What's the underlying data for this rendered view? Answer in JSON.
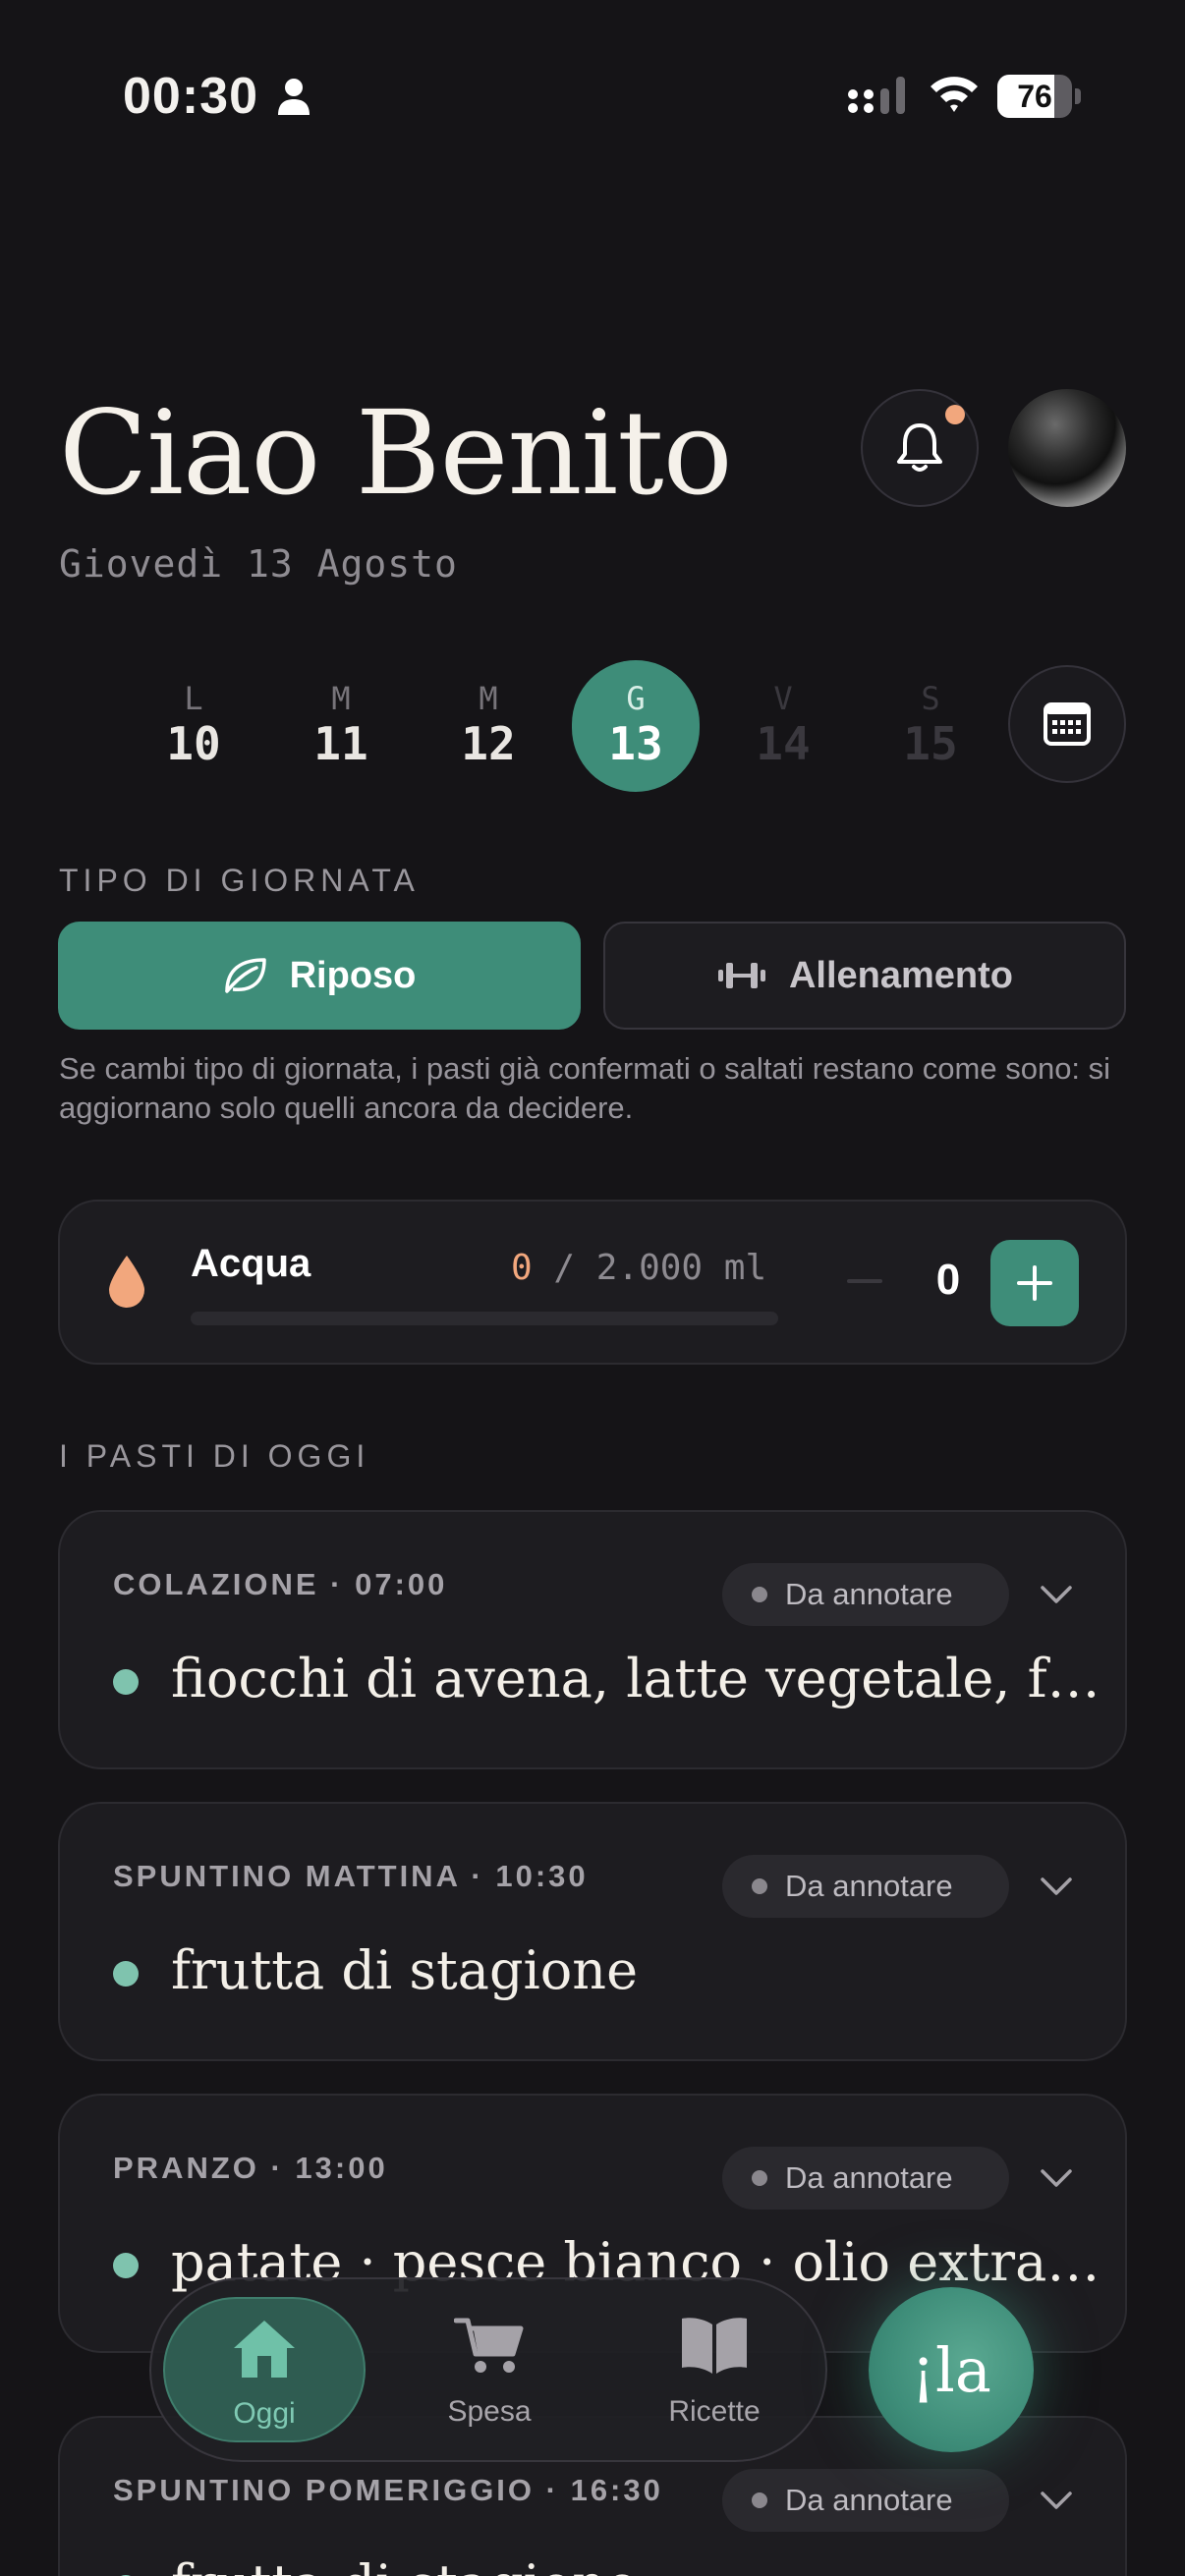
{
  "status_bar": {
    "time": "00:30",
    "battery": "76",
    "battery_level": 0.76
  },
  "header": {
    "greeting": "Ciao Benito",
    "date": "Giovedì 13 Agosto"
  },
  "week": {
    "days": [
      {
        "letter": "L",
        "num": "10"
      },
      {
        "letter": "M",
        "num": "11"
      },
      {
        "letter": "M",
        "num": "12"
      },
      {
        "letter": "G",
        "num": "13"
      },
      {
        "letter": "V",
        "num": "14"
      },
      {
        "letter": "S",
        "num": "15"
      }
    ],
    "active_index": 3
  },
  "day_type": {
    "label": "TIPO DI GIORNATA",
    "rest": "Riposo",
    "training": "Allenamento",
    "selected": "Riposo",
    "note": "Se cambi tipo di giornata, i pasti già confermati o saltati restano come sono: si aggiornano solo quelli ancora da decidere."
  },
  "water": {
    "title": "Acqua",
    "current": "0",
    "target": "/ 2.000 ml",
    "count": "0",
    "progress": 0
  },
  "meals": {
    "label": "I PASTI DI OGGI",
    "items": [
      {
        "name": "COLAZIONE · 07:00",
        "status": "Da annotare",
        "desc": "fiocchi di avena, latte vegetale, frutta di stagione"
      },
      {
        "name": "SPUNTINO MATTINA · 10:30",
        "status": "Da annotare",
        "desc": "frutta di stagione"
      },
      {
        "name": "PRANZO · 13:00",
        "status": "Da annotare",
        "desc": "patate · pesce bianco · olio extravergine"
      },
      {
        "name": "SPUNTINO POMERIGGIO · 16:30",
        "status": "Da annotare",
        "desc": "frutta di stagione"
      }
    ]
  },
  "nav": {
    "home": "Oggi",
    "shopping": "Spesa",
    "recipes": "Ricette",
    "fab": "¡la"
  },
  "colors": {
    "accent": "#3e8d79",
    "warm": "#f2a77d",
    "bg": "#151417",
    "card": "#1d1c20"
  }
}
